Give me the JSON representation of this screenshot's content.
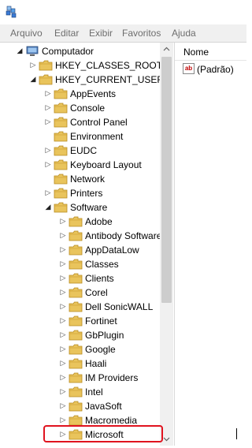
{
  "menu": [
    "Arquivo",
    "Editar",
    "Exibir",
    "Favoritos",
    "Ajuda"
  ],
  "list": {
    "column_header": "Nome",
    "values": [
      {
        "name": "(Padrão)",
        "icon": "string-value-icon"
      }
    ]
  },
  "tree": [
    {
      "label": "Computador",
      "level": 0,
      "expanded": true,
      "icon": "computer-icon"
    },
    {
      "label": "HKEY_CLASSES_ROOT",
      "level": 1,
      "expanded": false,
      "icon": "folder-icon"
    },
    {
      "label": "HKEY_CURRENT_USER",
      "level": 1,
      "expanded": true,
      "icon": "folder-icon"
    },
    {
      "label": "AppEvents",
      "level": 2,
      "expanded": false,
      "icon": "folder-icon"
    },
    {
      "label": "Console",
      "level": 2,
      "expanded": false,
      "icon": "folder-icon"
    },
    {
      "label": "Control Panel",
      "level": 2,
      "expanded": false,
      "icon": "folder-icon"
    },
    {
      "label": "Environment",
      "level": 2,
      "expanded": null,
      "icon": "folder-icon"
    },
    {
      "label": "EUDC",
      "level": 2,
      "expanded": false,
      "icon": "folder-icon"
    },
    {
      "label": "Keyboard Layout",
      "level": 2,
      "expanded": false,
      "icon": "folder-icon"
    },
    {
      "label": "Network",
      "level": 2,
      "expanded": null,
      "icon": "folder-icon"
    },
    {
      "label": "Printers",
      "level": 2,
      "expanded": false,
      "icon": "folder-icon"
    },
    {
      "label": "Software",
      "level": 2,
      "expanded": true,
      "icon": "folder-icon"
    },
    {
      "label": "Adobe",
      "level": 3,
      "expanded": false,
      "icon": "folder-icon"
    },
    {
      "label": "Antibody Software",
      "level": 3,
      "expanded": false,
      "icon": "folder-icon"
    },
    {
      "label": "AppDataLow",
      "level": 3,
      "expanded": false,
      "icon": "folder-icon"
    },
    {
      "label": "Classes",
      "level": 3,
      "expanded": false,
      "icon": "folder-icon"
    },
    {
      "label": "Clients",
      "level": 3,
      "expanded": false,
      "icon": "folder-icon"
    },
    {
      "label": "Corel",
      "level": 3,
      "expanded": false,
      "icon": "folder-icon"
    },
    {
      "label": "Dell SonicWALL",
      "level": 3,
      "expanded": false,
      "icon": "folder-icon"
    },
    {
      "label": "Fortinet",
      "level": 3,
      "expanded": false,
      "icon": "folder-icon"
    },
    {
      "label": "GbPlugin",
      "level": 3,
      "expanded": false,
      "icon": "folder-icon"
    },
    {
      "label": "Google",
      "level": 3,
      "expanded": false,
      "icon": "folder-icon"
    },
    {
      "label": "Haali",
      "level": 3,
      "expanded": false,
      "icon": "folder-icon"
    },
    {
      "label": "IM Providers",
      "level": 3,
      "expanded": false,
      "icon": "folder-icon"
    },
    {
      "label": "Intel",
      "level": 3,
      "expanded": false,
      "icon": "folder-icon"
    },
    {
      "label": "JavaSoft",
      "level": 3,
      "expanded": false,
      "icon": "folder-icon"
    },
    {
      "label": "Macromedia",
      "level": 3,
      "expanded": false,
      "icon": "folder-icon"
    },
    {
      "label": "Microsoft",
      "level": 3,
      "expanded": false,
      "icon": "folder-icon",
      "highlighted": true
    }
  ],
  "colors": {
    "menu_text": "#6d6d6d",
    "highlight_border": "#e0131f",
    "folder_fill": "#e9c45c"
  }
}
